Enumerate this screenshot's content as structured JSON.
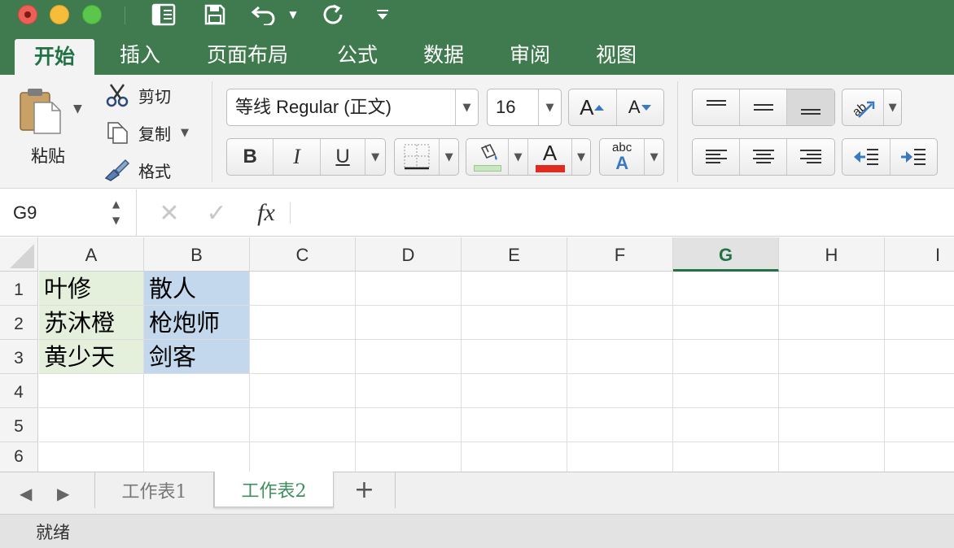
{
  "ribbon_tabs": [
    "开始",
    "插入",
    "页面布局",
    "公式",
    "数据",
    "审阅",
    "视图"
  ],
  "active_tab": "开始",
  "clipboard": {
    "paste_label": "粘贴",
    "cut_label": "剪切",
    "copy_label": "复制",
    "format_label": "格式"
  },
  "font": {
    "name": "等线 Regular (正文)",
    "size": "16",
    "bold": "B",
    "italic": "I",
    "underline": "U",
    "grow": "A",
    "shrink": "A",
    "color_letter": "A",
    "phonetic_small": "abc",
    "phonetic_big": "A"
  },
  "colors": {
    "accent": "#217346",
    "titlebar": "#3f7b4e",
    "font_color_bar": "#e02b20",
    "fill_color_bar": "#c9e8c0",
    "cell_green": "#e4efdc",
    "cell_blue": "#c4d8ed"
  },
  "formula_bar": {
    "name_box": "G9",
    "cancel": "✕",
    "enter": "✓",
    "fx": "fx",
    "content": ""
  },
  "columns": [
    "A",
    "B",
    "C",
    "D",
    "E",
    "F",
    "G",
    "H",
    "I"
  ],
  "selected_column": "G",
  "rows": [
    "1",
    "2",
    "3",
    "4",
    "5",
    "6"
  ],
  "cells": {
    "A1": "叶修",
    "A2": "苏沐橙",
    "A3": "黄少天",
    "B1": "散人",
    "B2": "枪炮师",
    "B3": "剑客"
  },
  "sheets": [
    "工作表1",
    "工作表2"
  ],
  "active_sheet": "工作表2",
  "add_sheet": "+",
  "status": "就绪"
}
